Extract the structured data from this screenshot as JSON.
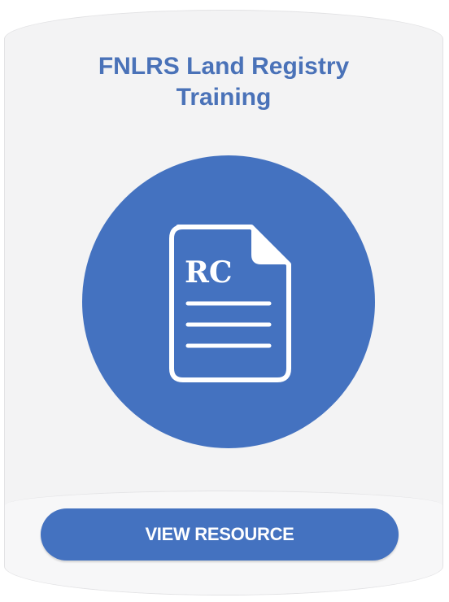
{
  "card": {
    "title_line1": "FNLRS Land Registry",
    "title_line2": "Training",
    "icon": "document-icon",
    "badge_text": "RC",
    "button_label": "VIEW RESOURCE"
  },
  "colors": {
    "accent": "#4472c0",
    "title": "#4a72b8",
    "card_background": "#f3f3f4"
  }
}
